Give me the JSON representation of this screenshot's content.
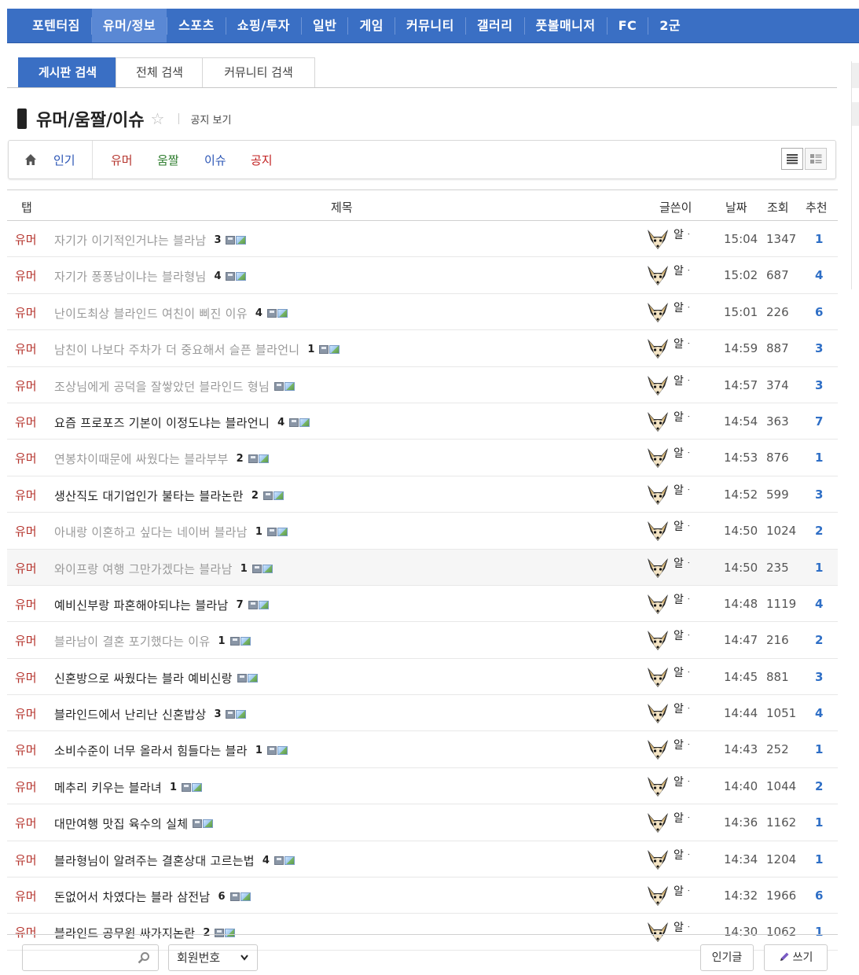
{
  "topnav": {
    "items": [
      "포텐터짐",
      "유머/정보",
      "스포츠",
      "쇼핑/투자",
      "일반",
      "게임",
      "커뮤니티",
      "갤러리",
      "풋볼매니저",
      "FC",
      "2군"
    ],
    "active_index": 1
  },
  "search_tabs": [
    "게시판 검색",
    "전체 검색",
    "커뮤니티 검색"
  ],
  "board": {
    "title": "유머/움짤/이슈",
    "notice_link": "공지 보기"
  },
  "categories": [
    {
      "label": "인기",
      "color": "#2b55b5"
    },
    {
      "label": "유머",
      "color": "#b5342d"
    },
    {
      "label": "움짤",
      "color": "#2e7d2e"
    },
    {
      "label": "이슈",
      "color": "#2b55b5"
    },
    {
      "label": "공지",
      "color": "#c21f1f"
    }
  ],
  "table": {
    "headers": {
      "tab": "탭",
      "subject": "제목",
      "writer": "글쓴이",
      "date": "날짜",
      "views": "조회",
      "rec": "추천"
    },
    "rows": [
      {
        "tab": "유머",
        "title": "자기가 이기적인거냐는 블라남",
        "cmt": "3",
        "writer": "알ᆞ",
        "date": "15:04",
        "views": "1347",
        "rec": "1",
        "read": true,
        "highlight": false
      },
      {
        "tab": "유머",
        "title": "자기가 퐁퐁남이냐는 블라형님",
        "cmt": "4",
        "writer": "알ᆞ",
        "date": "15:02",
        "views": "687",
        "rec": "4",
        "read": true,
        "highlight": false
      },
      {
        "tab": "유머",
        "title": "난이도최상 블라인드 여친이 삐진 이유",
        "cmt": "4",
        "writer": "알ᆞ",
        "date": "15:01",
        "views": "226",
        "rec": "6",
        "read": true,
        "highlight": false
      },
      {
        "tab": "유머",
        "title": "남친이 나보다 주차가 더 중요해서 슬픈 블라언니",
        "cmt": "1",
        "writer": "알ᆞ",
        "date": "14:59",
        "views": "887",
        "rec": "3",
        "read": true,
        "highlight": false
      },
      {
        "tab": "유머",
        "title": "조상님에게 공덕을 잘쌓았던 블라인드 형님",
        "cmt": "",
        "writer": "알ᆞ",
        "date": "14:57",
        "views": "374",
        "rec": "3",
        "read": true,
        "highlight": false
      },
      {
        "tab": "유머",
        "title": "요즘 프로포즈 기본이 이정도냐는 블라언니",
        "cmt": "4",
        "writer": "알ᆞ",
        "date": "14:54",
        "views": "363",
        "rec": "7",
        "read": false,
        "highlight": false
      },
      {
        "tab": "유머",
        "title": "연봉차이때문에 싸웠다는 블라부부",
        "cmt": "2",
        "writer": "알ᆞ",
        "date": "14:53",
        "views": "876",
        "rec": "1",
        "read": true,
        "highlight": false
      },
      {
        "tab": "유머",
        "title": "생산직도 대기업인가 불타는 블라논란",
        "cmt": "2",
        "writer": "알ᆞ",
        "date": "14:52",
        "views": "599",
        "rec": "3",
        "read": false,
        "highlight": false
      },
      {
        "tab": "유머",
        "title": "아내랑 이혼하고 싶다는 네이버 블라남",
        "cmt": "1",
        "writer": "알ᆞ",
        "date": "14:50",
        "views": "1024",
        "rec": "2",
        "read": true,
        "highlight": false
      },
      {
        "tab": "유머",
        "title": "와이프랑 여행 그만가겠다는 블라남",
        "cmt": "1",
        "writer": "알ᆞ",
        "date": "14:50",
        "views": "235",
        "rec": "1",
        "read": true,
        "highlight": true
      },
      {
        "tab": "유머",
        "title": "예비신부랑 파혼해야되냐는 블라남",
        "cmt": "7",
        "writer": "알ᆞ",
        "date": "14:48",
        "views": "1119",
        "rec": "4",
        "read": false,
        "highlight": false
      },
      {
        "tab": "유머",
        "title": "블라남이 결혼 포기했다는 이유",
        "cmt": "1",
        "writer": "알ᆞ",
        "date": "14:47",
        "views": "216",
        "rec": "2",
        "read": true,
        "highlight": false
      },
      {
        "tab": "유머",
        "title": "신혼방으로 싸웠다는 블라 예비신랑",
        "cmt": "",
        "writer": "알ᆞ",
        "date": "14:45",
        "views": "881",
        "rec": "3",
        "read": false,
        "highlight": false
      },
      {
        "tab": "유머",
        "title": "블라인드에서 난리난 신혼밥상",
        "cmt": "3",
        "writer": "알ᆞ",
        "date": "14:44",
        "views": "1051",
        "rec": "4",
        "read": false,
        "highlight": false
      },
      {
        "tab": "유머",
        "title": "소비수준이 너무 올라서 힘들다는 블라",
        "cmt": "1",
        "writer": "알ᆞ",
        "date": "14:43",
        "views": "252",
        "rec": "1",
        "read": false,
        "highlight": false
      },
      {
        "tab": "유머",
        "title": "메추리 키우는 블라녀",
        "cmt": "1",
        "writer": "알ᆞ",
        "date": "14:40",
        "views": "1044",
        "rec": "2",
        "read": false,
        "highlight": false
      },
      {
        "tab": "유머",
        "title": "대만여행 맛집 육수의 실체",
        "cmt": "",
        "writer": "알ᆞ",
        "date": "14:36",
        "views": "1162",
        "rec": "1",
        "read": false,
        "highlight": false
      },
      {
        "tab": "유머",
        "title": "블라형님이 알려주는 결혼상대 고르는법",
        "cmt": "4",
        "writer": "알ᆞ",
        "date": "14:34",
        "views": "1204",
        "rec": "1",
        "read": false,
        "highlight": false
      },
      {
        "tab": "유머",
        "title": "돈없어서 차였다는 블라 삼전남",
        "cmt": "6",
        "writer": "알ᆞ",
        "date": "14:32",
        "views": "1966",
        "rec": "6",
        "read": false,
        "highlight": false
      },
      {
        "tab": "유머",
        "title": "블라인드 공무원 싸가지논란",
        "cmt": "2",
        "writer": "알ᆞ",
        "date": "14:30",
        "views": "1062",
        "rec": "1",
        "read": false,
        "highlight": false
      }
    ]
  },
  "bottom": {
    "search_placeholder": "",
    "select_value": "회원번호",
    "popular_button": "인기글",
    "write_button": "쓰기"
  },
  "colors": {
    "nav_bg": "#3a6fc4",
    "nav_active": "#5a88d4",
    "tab_red": "#b5342d",
    "rec_blue": "#2f6fc6"
  }
}
